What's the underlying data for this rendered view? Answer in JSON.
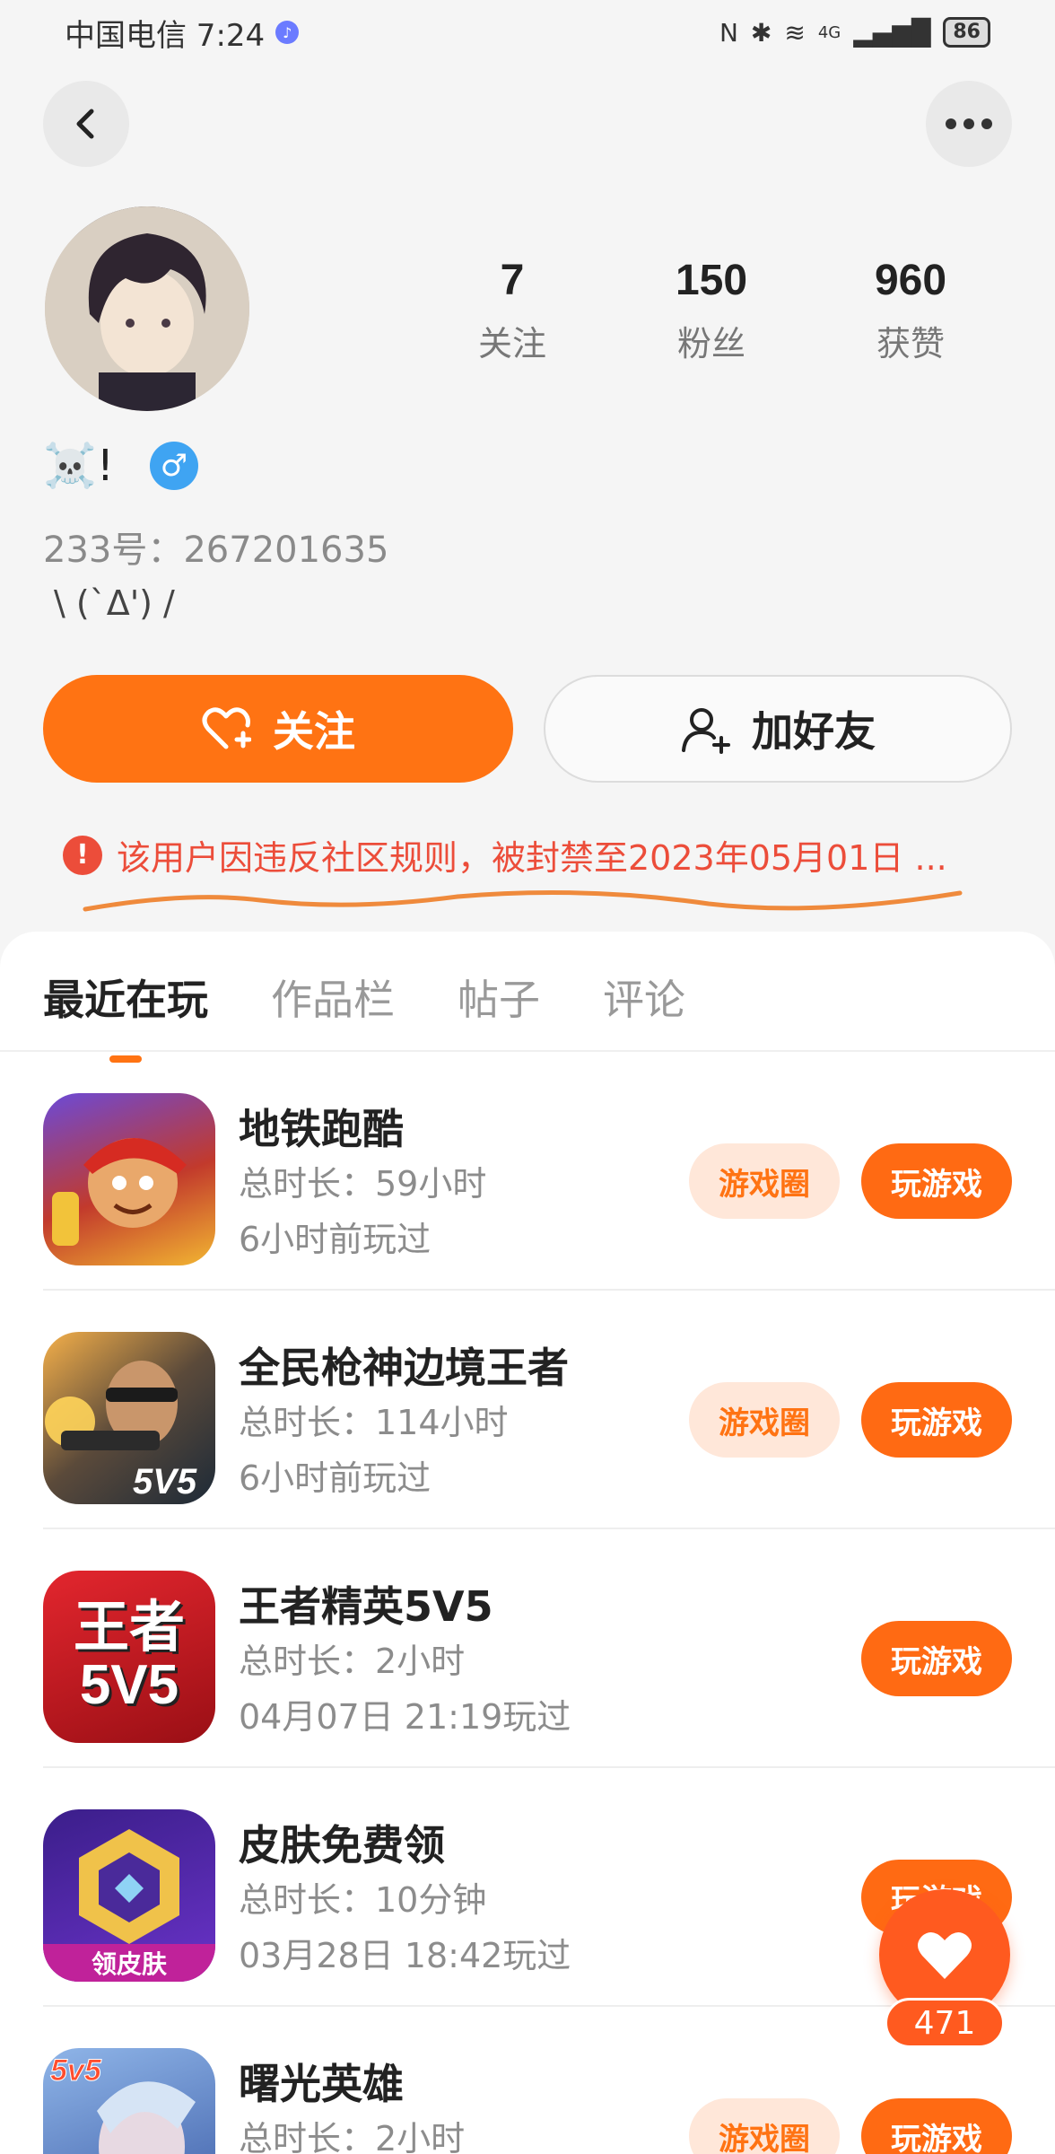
{
  "status_bar": {
    "carrier_time": "中国电信 7:24",
    "network": "4G",
    "battery": "86"
  },
  "profile": {
    "stats": [
      {
        "value": "7",
        "label": "关注"
      },
      {
        "value": "150",
        "label": "粉丝"
      },
      {
        "value": "960",
        "label": "获赞"
      }
    ],
    "nickname": "☠️!",
    "gender_symbol": "♂",
    "uid": "233号：267201635",
    "bio": "\\ (`Δ') /"
  },
  "actions": {
    "follow_label": "关注",
    "add_friend_label": "加好友"
  },
  "ban_notice": "该用户因违反社区规则，被封禁至2023年05月01日 ...",
  "tabs": [
    {
      "label": "最近在玩",
      "active": true
    },
    {
      "label": "作品栏",
      "active": false
    },
    {
      "label": "帖子",
      "active": false
    },
    {
      "label": "评论",
      "active": false
    }
  ],
  "games": [
    {
      "name": "地铁跑酷",
      "total_time": "总时长：59小时",
      "last_played": "6小时前玩过",
      "icon": "subway-surfers-icon",
      "has_circle": true
    },
    {
      "name": "全民枪神边境王者",
      "total_time": "总时长：114小时",
      "last_played": "6小时前玩过",
      "icon": "shooter-game-icon",
      "icon_text": "5V5",
      "has_circle": true
    },
    {
      "name": "王者精英5V5",
      "total_time": "总时长：2小时",
      "last_played": "04月07日 21:19玩过",
      "icon": "kings-elite-icon",
      "icon_text": "王者\n5V5",
      "has_circle": false
    },
    {
      "name": "皮肤免费领",
      "total_time": "总时长：10分钟",
      "last_played": "03月28日 18:42玩过",
      "icon": "free-skin-icon",
      "icon_text": "领皮肤",
      "has_circle": false
    },
    {
      "name": "曙光英雄",
      "total_time": "总时长：2小时",
      "last_played": "",
      "icon": "dawn-hero-icon",
      "icon_text": "5v5",
      "has_circle": true
    }
  ],
  "buttons": {
    "game_circle": "游戏圈",
    "play_game": "玩游戏"
  },
  "like_count": "471",
  "colors": {
    "accent": "#ff7313",
    "warning": "#ec4d3a"
  }
}
